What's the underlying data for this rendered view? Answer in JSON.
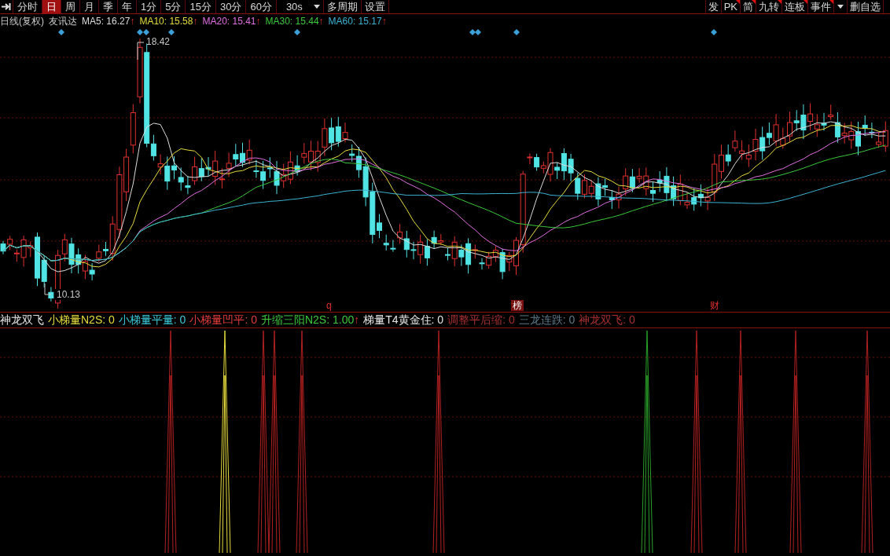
{
  "toolbar": {
    "periods": [
      {
        "label": "分时",
        "selected": false
      },
      {
        "label": "日",
        "selected": true
      },
      {
        "label": "周",
        "selected": false
      },
      {
        "label": "月",
        "selected": false
      },
      {
        "label": "季",
        "selected": false
      },
      {
        "label": "年",
        "selected": false
      },
      {
        "label": "1分",
        "selected": false
      },
      {
        "label": "5分",
        "selected": false
      },
      {
        "label": "15分",
        "selected": false
      },
      {
        "label": "30分",
        "selected": false
      },
      {
        "label": "60分",
        "selected": false
      }
    ],
    "interval": "30s",
    "actions": [
      "多周期",
      "设置"
    ],
    "right_buttons": [
      {
        "label": "发",
        "flagged": false
      },
      {
        "label": "PK",
        "flagged": true
      },
      {
        "label": "简",
        "flagged": true
      },
      {
        "label": "九转",
        "flagged": true
      },
      {
        "label": "连板",
        "flagged": true
      },
      {
        "label": "事件",
        "flagged": true
      }
    ],
    "watchlist_button": "删自选"
  },
  "legend": {
    "title": "日线(复权)",
    "stock": "友讯达",
    "averages": [
      {
        "name": "MA5:",
        "value": "16.27",
        "arrow": "↑",
        "color": "#dcdcdc"
      },
      {
        "name": "MA10:",
        "value": "15.58",
        "arrow": "↑",
        "color": "#e6dc3c"
      },
      {
        "name": "MA20:",
        "value": "15.41",
        "arrow": "↑",
        "color": "#e070e0"
      },
      {
        "name": "MA30:",
        "value": "15.44",
        "arrow": "↑",
        "color": "#3cc83c"
      },
      {
        "name": "MA60:",
        "value": "15.17",
        "arrow": "↑",
        "color": "#3cb4d2"
      }
    ]
  },
  "chart": {
    "high_label": "18.42",
    "low_label": "10.13",
    "events": [
      {
        "label": "q",
        "kind": "text"
      },
      {
        "label": "榜",
        "kind": "badge"
      },
      {
        "label": "财",
        "kind": "text"
      }
    ]
  },
  "indicator": {
    "title": "神龙双飞",
    "lines": [
      {
        "name": "小梯量N2S:",
        "value": "0",
        "color": "#e6dc3c"
      },
      {
        "name": "小梯量平量:",
        "value": "0",
        "color": "#3cc8d8"
      },
      {
        "name": "小梯量凹平:",
        "value": "0",
        "color": "#e03c3c"
      },
      {
        "name": "升缩三阳N2S:",
        "value": "1.00",
        "arrow": "↑",
        "color": "#3cc83c"
      },
      {
        "name": "梯量T4黄金住:",
        "value": "0",
        "color": "#e6e6e6"
      },
      {
        "name": "调整平后缩:",
        "value": "0",
        "color": "#a83030"
      },
      {
        "name": "三龙连跌:",
        "value": "0",
        "color": "#5a7888"
      },
      {
        "name": "神龙双飞:",
        "value": "0",
        "color": "#a83030"
      }
    ]
  }
}
